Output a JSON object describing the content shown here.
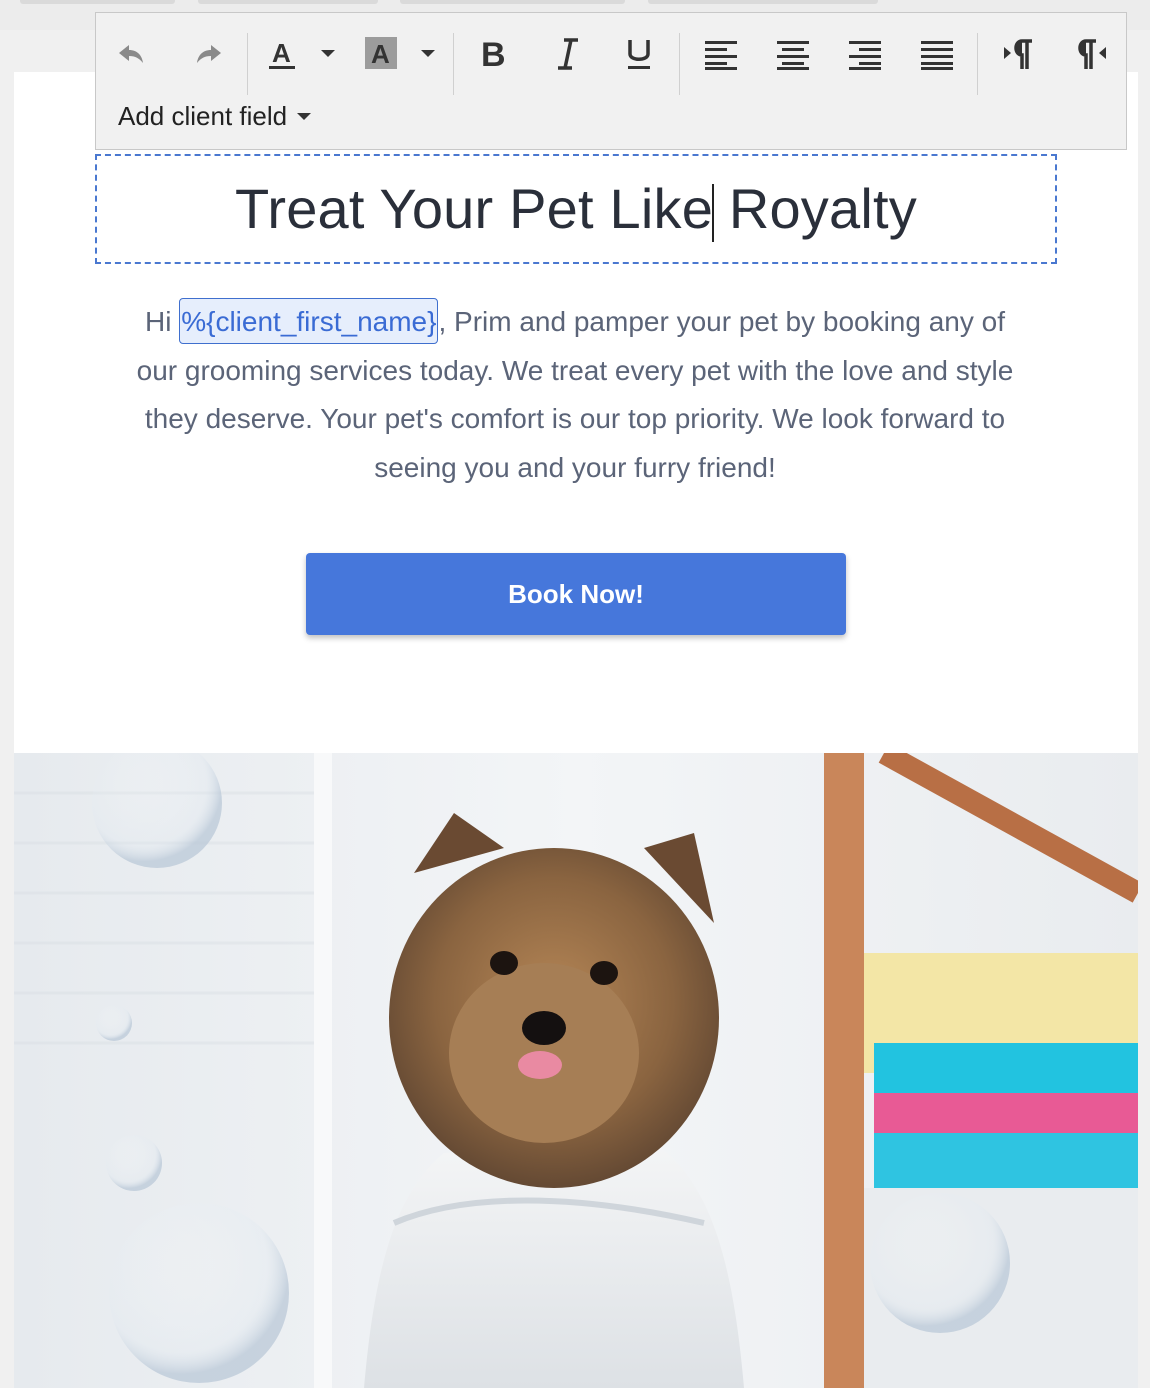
{
  "toolbar": {
    "buttons": [
      {
        "name": "undo-button",
        "icon": "undo-icon"
      },
      {
        "name": "redo-button",
        "icon": "redo-icon"
      },
      {
        "name": "text-color-button",
        "icon": "text-color-icon"
      },
      {
        "name": "highlight-color-button",
        "icon": "highlight-icon"
      },
      {
        "name": "bold-button",
        "icon": "bold-icon"
      },
      {
        "name": "italic-button",
        "icon": "italic-icon"
      },
      {
        "name": "underline-button",
        "icon": "underline-icon"
      },
      {
        "name": "align-left-button",
        "icon": "align-left-icon"
      },
      {
        "name": "align-center-button",
        "icon": "align-center-icon"
      },
      {
        "name": "align-right-button",
        "icon": "align-right-icon"
      },
      {
        "name": "justify-button",
        "icon": "justify-icon"
      },
      {
        "name": "ltr-direction-button",
        "icon": "paragraph-ltr-icon"
      },
      {
        "name": "rtl-direction-button",
        "icon": "paragraph-rtl-icon"
      }
    ],
    "add_client_field_label": "Add client field"
  },
  "headline": {
    "before_cursor": "Treat Your Pet Like",
    "after_cursor": " Royalty"
  },
  "body": {
    "greeting": "Hi ",
    "token": "%{client_first_name}",
    "text": ", Prim and pamper your pet by booking any of our grooming services today. We treat every pet with the love and style they deserve. Your pet's comfort is our top priority. We look forward to seeing you and your furry friend!"
  },
  "cta": {
    "label": "Book Now!"
  },
  "colors": {
    "accent": "#4677db",
    "token_border": "#3f6fce",
    "headline_border": "#4a78d0",
    "body_text": "#5b6478"
  },
  "image": {
    "icon": "pet-photo"
  }
}
